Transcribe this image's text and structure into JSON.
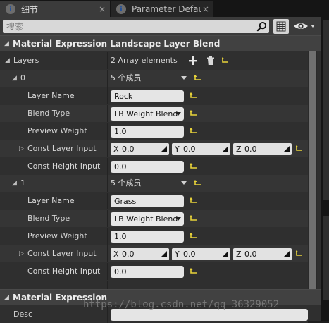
{
  "tabs": [
    {
      "label": "细节",
      "close": "×",
      "active": true
    },
    {
      "label": "Parameter Defaults",
      "close": "×",
      "active": false
    }
  ],
  "search": {
    "placeholder": "搜索"
  },
  "section_main": {
    "title": "Material Expression Landscape Layer Blend"
  },
  "layers": {
    "label": "Layers",
    "count": "2 Array elements",
    "items": [
      {
        "index": "0",
        "members": "5 个成员",
        "layer_name_label": "Layer Name",
        "layer_name_value": "Rock",
        "blend_type_label": "Blend Type",
        "blend_type_value": "LB Weight Blend",
        "preview_weight_label": "Preview Weight",
        "preview_weight_value": "1.0",
        "const_layer_input_label": "Const Layer Input",
        "const_layer_input": {
          "x_axis": "X",
          "x": "0.0",
          "y_axis": "Y",
          "y": "0.0",
          "z_axis": "Z",
          "z": "0.0"
        },
        "const_height_input_label": "Const Height Input",
        "const_height_input_value": "0.0"
      },
      {
        "index": "1",
        "members": "5 个成员",
        "layer_name_label": "Layer Name",
        "layer_name_value": "Grass",
        "blend_type_label": "Blend Type",
        "blend_type_value": "LB Weight Blend",
        "preview_weight_label": "Preview Weight",
        "preview_weight_value": "1.0",
        "const_layer_input_label": "Const Layer Input",
        "const_layer_input": {
          "x_axis": "X",
          "x": "0.0",
          "y_axis": "Y",
          "y": "0.0",
          "z_axis": "Z",
          "z": "0.0"
        },
        "const_height_input_label": "Const Height Input",
        "const_height_input_value": "0.0"
      }
    ]
  },
  "section_expression": {
    "title": "Material Expression",
    "desc_label": "Desc"
  },
  "watermark": "https://blog.csdn.net/qq_36329052",
  "colors": {
    "reset_arrow": "#e8d33a",
    "field_bg": "#e5e5e5",
    "panel_bg": "#2f2f2f",
    "header_bg": "#414141"
  }
}
